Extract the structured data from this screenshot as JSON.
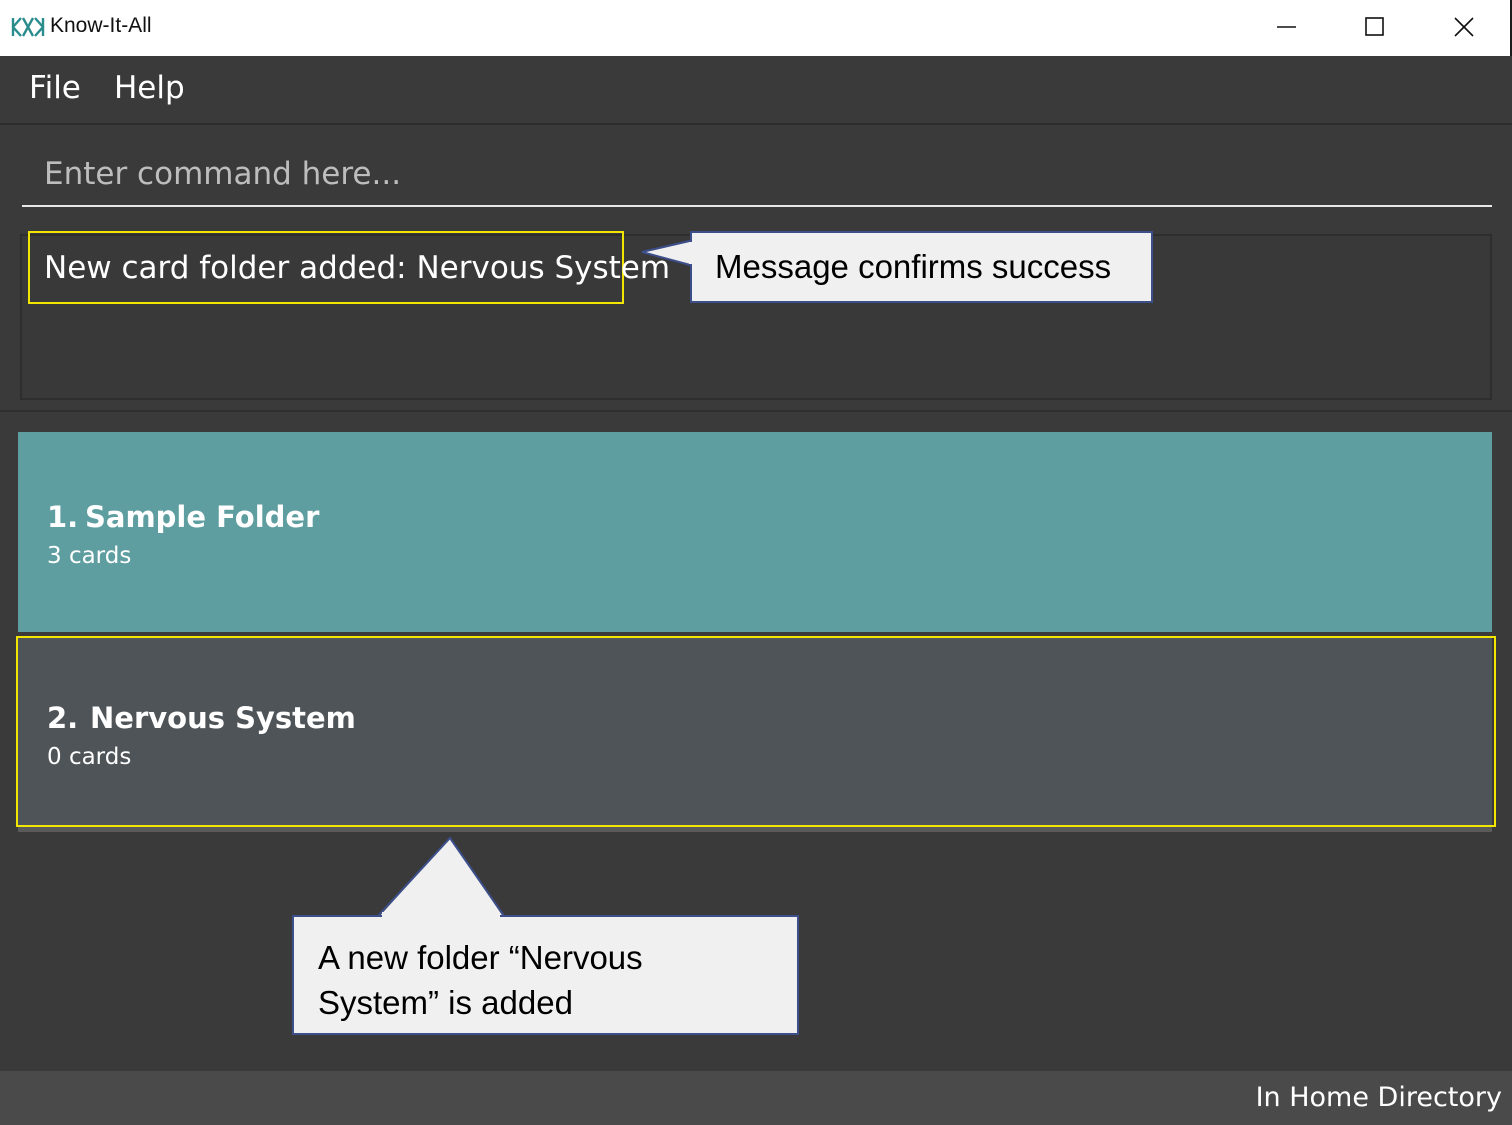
{
  "window": {
    "title": "Know-It-All",
    "icons": {
      "logo": "kia-logo-icon",
      "minimize": "minimize-icon",
      "maximize": "maximize-icon",
      "close": "close-icon"
    }
  },
  "menu": {
    "items": [
      {
        "label": "File"
      },
      {
        "label": "Help"
      }
    ]
  },
  "command": {
    "placeholder": "Enter command here..."
  },
  "result": {
    "message": "New card folder added: Nervous System"
  },
  "folders": [
    {
      "index": "1.",
      "name": "Sample Folder",
      "count": "3 cards",
      "selected": true
    },
    {
      "index": "2.",
      "name": "Nervous System",
      "count": "0 cards",
      "selected": false
    }
  ],
  "annotations": {
    "message_callout": "Message confirms success",
    "folder_callout_line1": "A new folder “Nervous",
    "folder_callout_line2": "System” is added"
  },
  "status": {
    "text": "In Home Directory"
  },
  "colors": {
    "background": "#3a3a3a",
    "selected_folder": "#5f9ea0",
    "folder": "#4f5458",
    "highlight": "#f2e500",
    "callout_border": "#3d4f8b"
  }
}
